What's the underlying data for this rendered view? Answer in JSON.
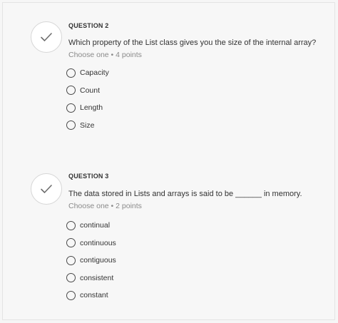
{
  "questions": [
    {
      "number_label": "QUESTION 2",
      "text": "Which property of the List class gives you the size of the internal array?",
      "meta": "Choose one • 4 points",
      "options": [
        "Capacity",
        "Count",
        "Length",
        "Size"
      ]
    },
    {
      "number_label": "QUESTION 3",
      "text": "The data stored in Lists and arrays is said to be ______ in memory.",
      "meta": "Choose one • 2 points",
      "options": [
        "continual",
        "continuous",
        "contiguous",
        "consistent",
        "constant"
      ]
    }
  ],
  "icons": {
    "status": "checkmark-icon",
    "option": "radio-button-icon"
  },
  "colors": {
    "background": "#f6f6f6",
    "circle_fill": "#ffffff",
    "circle_border": "#d6d6d6",
    "checkmark": "#6e6e6e",
    "text": "#333333",
    "meta_text": "#8a8a8a",
    "radio_border": "#4a4a4a"
  }
}
